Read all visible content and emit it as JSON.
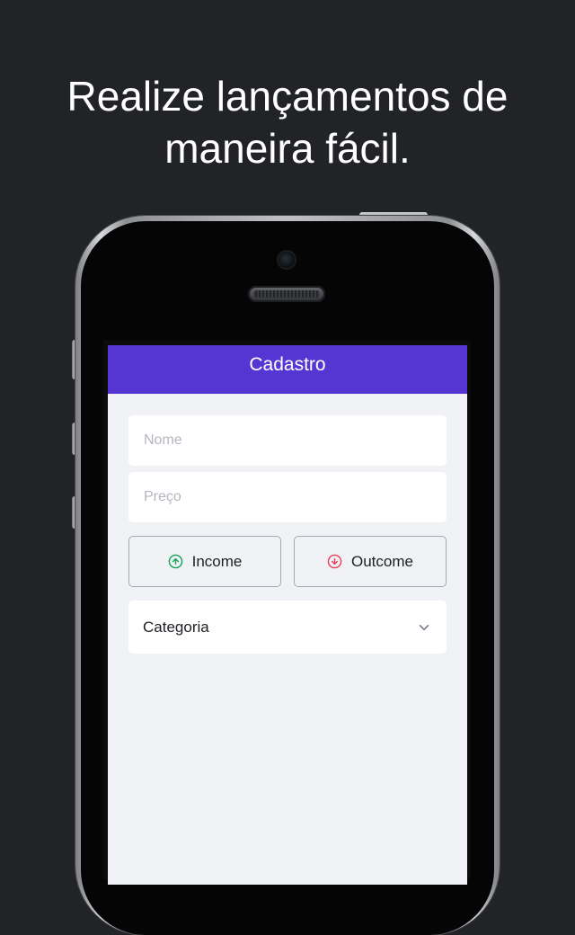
{
  "headline": {
    "line1": "Realize lançamentos de",
    "line2": "maneira fácil."
  },
  "app": {
    "title": "Cadastro",
    "form": {
      "name_placeholder": "Nome",
      "price_placeholder": "Preço",
      "income_label": "Income",
      "outcome_label": "Outcome",
      "category_label": "Categoria"
    },
    "icons": {
      "income": "arrow-up-circle-icon",
      "outcome": "arrow-down-circle-icon",
      "category": "chevron-down-icon"
    },
    "colors": {
      "header": "#5636d3",
      "income": "#12a454",
      "outcome": "#e83f5b",
      "background": "#f0f2f5"
    }
  }
}
